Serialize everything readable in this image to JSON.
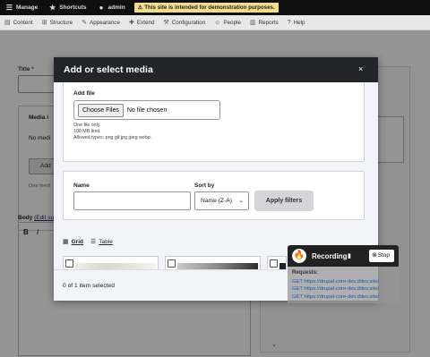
{
  "toolbar": {
    "manage": "Manage",
    "shortcuts": "Shortcuts",
    "user": "admin",
    "warning": "This site is intended for demonstration purposes."
  },
  "admin_menu": {
    "items": [
      "Content",
      "Structure",
      "Appearance",
      "Extend",
      "Configuration",
      "People",
      "Reports",
      "Help"
    ]
  },
  "page": {
    "title_label": "Title",
    "title_required": "*",
    "media_label": "Media i",
    "no_media": "No medi",
    "add_button": "Add",
    "one_media": "One medi",
    "body_label": "Body",
    "body_link": "(Edit su",
    "bold": "B",
    "italic": "I"
  },
  "dialog": {
    "title": "Add or select media",
    "close": "×",
    "add_file_label": "Add file",
    "choose_button": "Choose Files",
    "file_status": "No file chosen",
    "help_lines": [
      "One file only.",
      "100 MB limit.",
      "Allowed types: png gif jpg jpeg webp."
    ],
    "name_label": "Name",
    "sort_label": "Sort by",
    "sort_value": "Name (Z-A)",
    "apply_button": "Apply filters",
    "views": [
      {
        "label": "Grid",
        "icon": "grid-icon",
        "active": true
      },
      {
        "label": "Table",
        "icon": "list-icon",
        "active": false
      }
    ],
    "selected_count": "0 of 1 item selected"
  },
  "recorder": {
    "title": "Recording",
    "stop": "Stop",
    "requests_label": "Requests:",
    "requests": [
      "GET https://drupal-core-dev.ddev.site/",
      "GET https://drupal-core-dev.ddev.site/",
      "GET https://drupal-core-dev.ddev.site/"
    ]
  }
}
